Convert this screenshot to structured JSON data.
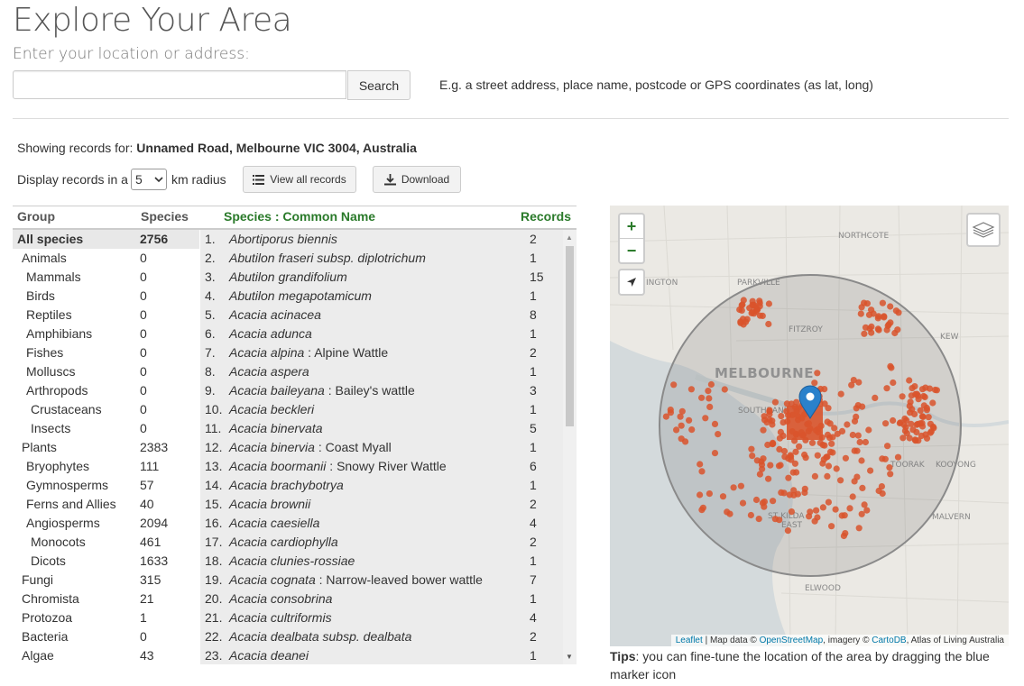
{
  "header": {
    "title": "Explore Your Area",
    "subtitle": "Enter your location or address:",
    "search_button": "Search",
    "search_value": "",
    "hint": "E.g. a street address, place name, postcode or GPS coordinates (as lat, long)"
  },
  "showing": {
    "prefix": "Showing records for:",
    "location": "Unnamed Road, Melbourne VIC 3004, Australia"
  },
  "radius": {
    "prefix": "Display records in a",
    "value": "5",
    "suffix": "km radius"
  },
  "buttons": {
    "view_all": "View all records",
    "download": "Download"
  },
  "table": {
    "group_header": "Group",
    "species_header": "Species",
    "name_header": "Species : Common Name",
    "records_header": "Records"
  },
  "groups": [
    {
      "name": "All species",
      "count": "2756",
      "level": 0,
      "selected": true
    },
    {
      "name": "Animals",
      "count": "0",
      "level": 1
    },
    {
      "name": "Mammals",
      "count": "0",
      "level": 2
    },
    {
      "name": "Birds",
      "count": "0",
      "level": 2
    },
    {
      "name": "Reptiles",
      "count": "0",
      "level": 2
    },
    {
      "name": "Amphibians",
      "count": "0",
      "level": 2
    },
    {
      "name": "Fishes",
      "count": "0",
      "level": 2
    },
    {
      "name": "Molluscs",
      "count": "0",
      "level": 2
    },
    {
      "name": "Arthropods",
      "count": "0",
      "level": 2
    },
    {
      "name": "Crustaceans",
      "count": "0",
      "level": 3
    },
    {
      "name": "Insects",
      "count": "0",
      "level": 3
    },
    {
      "name": "Plants",
      "count": "2383",
      "level": 1
    },
    {
      "name": "Bryophytes",
      "count": "111",
      "level": 2
    },
    {
      "name": "Gymnosperms",
      "count": "57",
      "level": 2
    },
    {
      "name": "Ferns and Allies",
      "count": "40",
      "level": 2
    },
    {
      "name": "Angiosperms",
      "count": "2094",
      "level": 2
    },
    {
      "name": "Monocots",
      "count": "461",
      "level": 3
    },
    {
      "name": "Dicots",
      "count": "1633",
      "level": 3
    },
    {
      "name": "Fungi",
      "count": "315",
      "level": 1
    },
    {
      "name": "Chromista",
      "count": "21",
      "level": 1
    },
    {
      "name": "Protozoa",
      "count": "1",
      "level": 1
    },
    {
      "name": "Bacteria",
      "count": "0",
      "level": 1
    },
    {
      "name": "Algae",
      "count": "43",
      "level": 1
    }
  ],
  "species": [
    {
      "num": "1.",
      "name": "Abortiporus biennis",
      "common": "",
      "records": "2"
    },
    {
      "num": "2.",
      "name": "Abutilon fraseri subsp. diplotrichum",
      "common": "",
      "records": "1"
    },
    {
      "num": "3.",
      "name": "Abutilon grandifolium",
      "common": "",
      "records": "15"
    },
    {
      "num": "4.",
      "name": "Abutilon megapotamicum",
      "common": "",
      "records": "1"
    },
    {
      "num": "5.",
      "name": "Acacia acinacea",
      "common": "",
      "records": "8"
    },
    {
      "num": "6.",
      "name": "Acacia adunca",
      "common": "",
      "records": "1"
    },
    {
      "num": "7.",
      "name": "Acacia alpina",
      "common": "Alpine Wattle",
      "records": "2"
    },
    {
      "num": "8.",
      "name": "Acacia aspera",
      "common": "",
      "records": "1"
    },
    {
      "num": "9.",
      "name": "Acacia baileyana",
      "common": "Bailey's wattle",
      "records": "3"
    },
    {
      "num": "10.",
      "name": "Acacia beckleri",
      "common": "",
      "records": "1"
    },
    {
      "num": "11.",
      "name": "Acacia binervata",
      "common": "",
      "records": "5"
    },
    {
      "num": "12.",
      "name": "Acacia binervia",
      "common": "Coast Myall",
      "records": "1"
    },
    {
      "num": "13.",
      "name": "Acacia boormanii",
      "common": "Snowy River Wattle",
      "records": "6"
    },
    {
      "num": "14.",
      "name": "Acacia brachybotrya",
      "common": "",
      "records": "1"
    },
    {
      "num": "15.",
      "name": "Acacia brownii",
      "common": "",
      "records": "2"
    },
    {
      "num": "16.",
      "name": "Acacia caesiella",
      "common": "",
      "records": "4"
    },
    {
      "num": "17.",
      "name": "Acacia cardiophylla",
      "common": "",
      "records": "2"
    },
    {
      "num": "18.",
      "name": "Acacia clunies-rossiae",
      "common": "",
      "records": "1"
    },
    {
      "num": "19.",
      "name": "Acacia cognata",
      "common": "Narrow-leaved bower wattle",
      "records": "7"
    },
    {
      "num": "20.",
      "name": "Acacia consobrina",
      "common": "",
      "records": "1"
    },
    {
      "num": "21.",
      "name": "Acacia cultriformis",
      "common": "",
      "records": "4"
    },
    {
      "num": "22.",
      "name": "Acacia dealbata subsp. dealbata",
      "common": "",
      "records": "2"
    },
    {
      "num": "23.",
      "name": "Acacia deanei",
      "common": "",
      "records": "1"
    }
  ],
  "map": {
    "zoom_in": "+",
    "zoom_out": "−",
    "labels": {
      "melbourne": "MELBOURNE",
      "northcote": "NORTHCOTE",
      "parkville": "PARKVILLE",
      "kensington": "INGTON",
      "fitzroy": "FITZROY",
      "kew": "KEW",
      "southbank": "SOUTHBANK",
      "toorak": "TOORAK",
      "kooyong": "KOOYONG",
      "stkilda": "ST KILDA",
      "stkilda2": "EAST",
      "malvern": "MALVERN",
      "elwood": "ELWOOD"
    },
    "attribution": {
      "leaflet": "Leaflet",
      "mapdata": "| Map data ©",
      "osm": "OpenStreetMap",
      "imagery": ", imagery ©",
      "cartodb": "CartoDB",
      "ala": ", Atlas of Living Australia"
    },
    "colors": {
      "points": "#d9542c",
      "marker": "#2a81cb",
      "circle": "#888888"
    }
  },
  "tips": {
    "label": "Tips",
    "text": ": you can fine-tune the location of the area by dragging the blue marker icon"
  }
}
